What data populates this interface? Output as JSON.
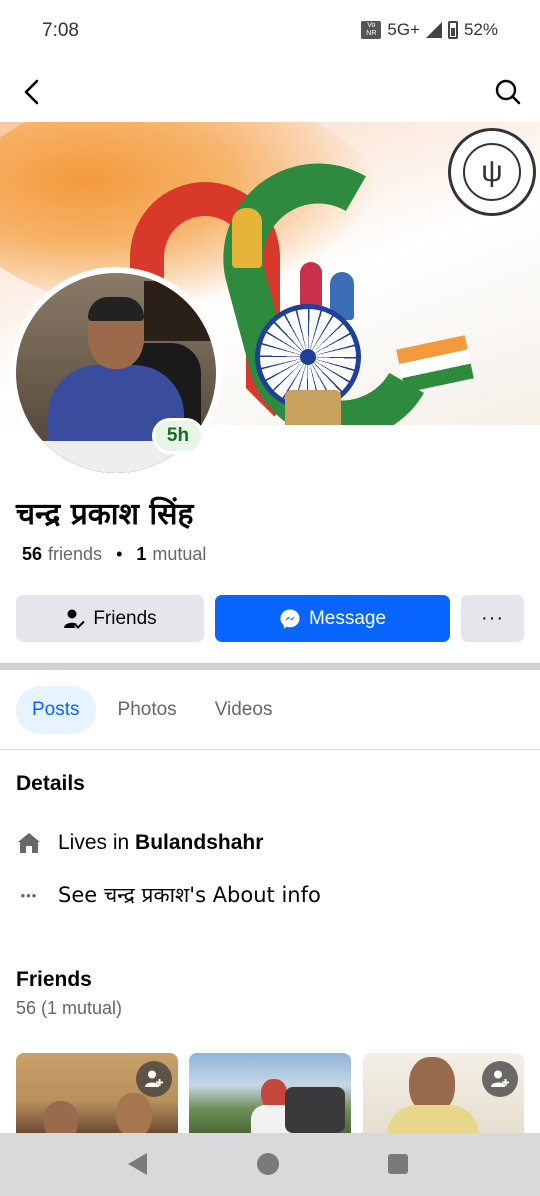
{
  "status_bar": {
    "time": "7:08",
    "volte": "Vo NR",
    "network": "5G+",
    "battery": "52%"
  },
  "top_nav": {
    "back_icon": "chevron-left-icon",
    "search_icon": "search-icon"
  },
  "cover": {
    "seal_glyph": "ψ"
  },
  "profile": {
    "name": "चन्द्र प्रकाश सिंह",
    "story_badge": "5h",
    "friends_count": "56",
    "friends_label": "friends",
    "separator": "•",
    "mutual_count": "1",
    "mutual_label": "mutual"
  },
  "actions": {
    "friends_label": "Friends",
    "message_label": "Message",
    "more_label": "···"
  },
  "tabs": [
    {
      "label": "Posts",
      "active": true
    },
    {
      "label": "Photos",
      "active": false
    },
    {
      "label": "Videos",
      "active": false
    }
  ],
  "details": {
    "title": "Details",
    "lives_prefix": "Lives in ",
    "lives_city": "Bulandshahr",
    "about_link": "See चन्द्र प्रकाश's About info",
    "more_glyph": "•••"
  },
  "friends_section": {
    "title": "Friends",
    "count": "56 (1 mutual)"
  },
  "colors": {
    "primary": "#0866ff",
    "button_gray": "#e4e6eb",
    "active_tab_bg": "#e7f3ff",
    "text_secondary": "#65676b"
  }
}
